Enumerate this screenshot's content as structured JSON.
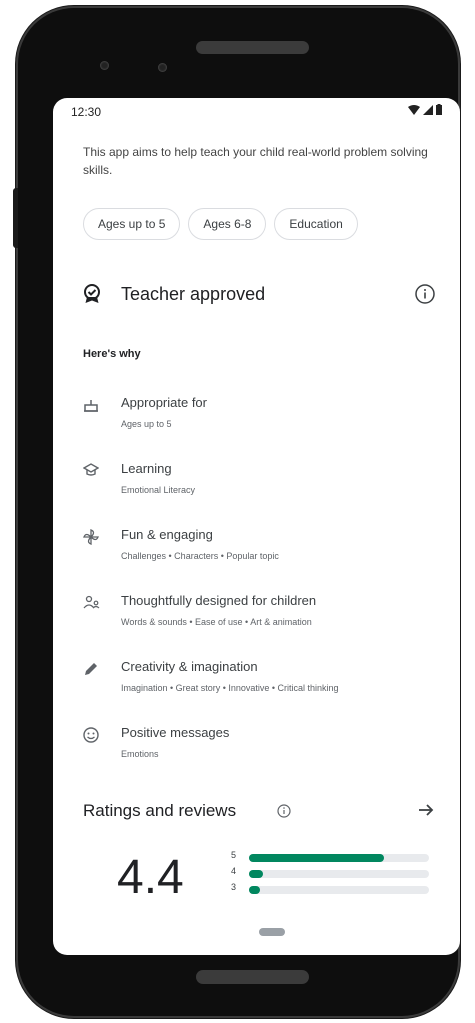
{
  "statusbar": {
    "time": "12:30"
  },
  "description": "This app aims to help teach your child real-world problem solving skills.",
  "chips": [
    "Ages up to 5",
    "Ages 6-8",
    "Education"
  ],
  "teacher_approved": {
    "title": "Teacher approved",
    "heres_why": "Here's why"
  },
  "reasons": [
    {
      "icon": "cake-icon",
      "title": "Appropriate for",
      "subtitle": "Ages up to 5"
    },
    {
      "icon": "school-icon",
      "title": "Learning",
      "subtitle": "Emotional Literacy"
    },
    {
      "icon": "pinwheel-icon",
      "title": "Fun & engaging",
      "subtitle": "Challenges • Characters • Popular topic"
    },
    {
      "icon": "family-icon",
      "title": "Thoughtfully designed for children",
      "subtitle": "Words & sounds • Ease of use • Art & animation"
    },
    {
      "icon": "pencil-icon",
      "title": "Creativity & imagination",
      "subtitle": "Imagination • Great story • Innovative • Critical thinking"
    },
    {
      "icon": "smiley-icon",
      "title": "Positive messages",
      "subtitle": "Emotions"
    }
  ],
  "ratings": {
    "title": "Ratings and reviews",
    "score": "4.4",
    "bars": [
      {
        "label": "5",
        "fraction": 0.75
      },
      {
        "label": "4",
        "fraction": 0.08
      },
      {
        "label": "3",
        "fraction": 0.06
      }
    ]
  },
  "colors": {
    "accent": "#01875f",
    "track": "#e8eaed"
  }
}
